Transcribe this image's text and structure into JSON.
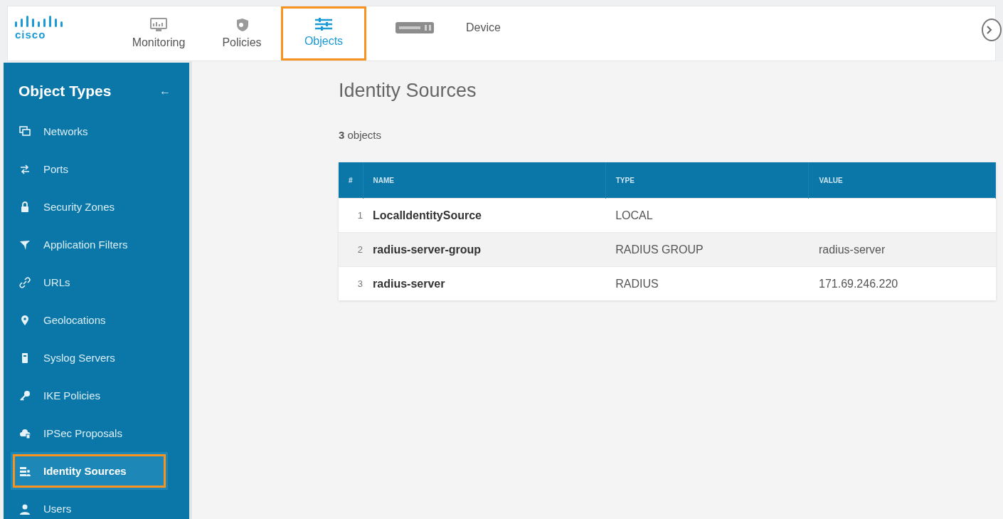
{
  "header": {
    "logo": "cisco",
    "tabs": [
      {
        "label": "Monitoring",
        "kind": "monitor",
        "selected": false,
        "highlighted": false
      },
      {
        "label": "Policies",
        "kind": "shield",
        "selected": false,
        "highlighted": false
      },
      {
        "label": "Objects",
        "kind": "sliders",
        "selected": true,
        "highlighted": true
      },
      {
        "label": "Device",
        "kind": "device",
        "selected": false,
        "highlighted": false
      }
    ]
  },
  "sidebar": {
    "title": "Object Types",
    "back": "←",
    "items": [
      {
        "label": "Networks",
        "kind": "networks",
        "selected": false,
        "highlighted": false
      },
      {
        "label": "Ports",
        "kind": "ports",
        "selected": false,
        "highlighted": false
      },
      {
        "label": "Security Zones",
        "kind": "lock",
        "selected": false,
        "highlighted": false
      },
      {
        "label": "Application Filters",
        "kind": "filter",
        "selected": false,
        "highlighted": false
      },
      {
        "label": "URLs",
        "kind": "link",
        "selected": false,
        "highlighted": false
      },
      {
        "label": "Geolocations",
        "kind": "pin",
        "selected": false,
        "highlighted": false
      },
      {
        "label": "Syslog Servers",
        "kind": "server",
        "selected": false,
        "highlighted": false
      },
      {
        "label": "IKE Policies",
        "kind": "key",
        "selected": false,
        "highlighted": false
      },
      {
        "label": "IPSec Proposals",
        "kind": "cloud",
        "selected": false,
        "highlighted": false
      },
      {
        "label": "Identity Sources",
        "kind": "identity",
        "selected": true,
        "highlighted": true
      },
      {
        "label": "Users",
        "kind": "user",
        "selected": false,
        "highlighted": false
      }
    ]
  },
  "main": {
    "title": "Identity Sources",
    "count": "**3** objects",
    "table": {
      "columns": [
        "#",
        "NAME",
        "TYPE",
        "VALUE"
      ],
      "rows": [
        [
          "1",
          "LocalIdentitySource",
          "LOCAL",
          ""
        ],
        [
          "2",
          "radius-server-group",
          "RADIUS GROUP",
          "radius-server"
        ],
        [
          "3",
          "radius-server",
          "RADIUS",
          "171.69.246.220"
        ]
      ]
    }
  }
}
